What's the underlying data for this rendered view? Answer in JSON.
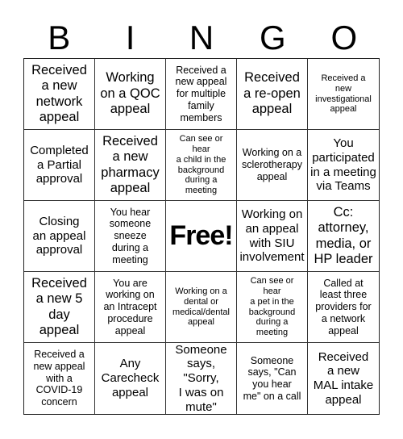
{
  "title_letters": [
    "B",
    "I",
    "N",
    "G",
    "O"
  ],
  "cells": [
    {
      "text": "Received\na new\nnetwork\nappeal",
      "size": "xl"
    },
    {
      "text": "Working\non a QOC\nappeal",
      "size": "xl"
    },
    {
      "text": "Received a\nnew appeal\nfor multiple\nfamily\nmembers",
      "size": "md"
    },
    {
      "text": "Received\na re-open\nappeal",
      "size": "xl"
    },
    {
      "text": "Received a\nnew\ninvestigational\nappeal",
      "size": "sm"
    },
    {
      "text": "Completed\na Partial\napproval",
      "size": "lg"
    },
    {
      "text": "Received\na new\npharmacy\nappeal",
      "size": "xl"
    },
    {
      "text": "Can see or\nhear\na child in the\nbackground\nduring a\nmeeting",
      "size": "sm"
    },
    {
      "text": "Working on a\nsclerotherapy\nappeal",
      "size": "md"
    },
    {
      "text": "You\nparticipated\nin a meeting\nvia Teams",
      "size": "lg"
    },
    {
      "text": "Closing\nan appeal\napproval",
      "size": "lg"
    },
    {
      "text": "You hear\nsomeone\nsneeze\nduring a\nmeeting",
      "size": "md"
    },
    {
      "text": "Free!",
      "size": "free"
    },
    {
      "text": "Working on\nan appeal\nwith SIU\ninvolvement",
      "size": "lg"
    },
    {
      "text": "Cc:\nattorney,\nmedia, or\nHP leader",
      "size": "xl"
    },
    {
      "text": "Received\na new 5\nday\nappeal",
      "size": "xl"
    },
    {
      "text": "You are\nworking on\nan Intracept\nprocedure\nappeal",
      "size": "md"
    },
    {
      "text": "Working on a\ndental or\nmedical/dental\nappeal",
      "size": "sm"
    },
    {
      "text": "Can see or\nhear\na pet in the\nbackground\nduring a\nmeeting",
      "size": "sm"
    },
    {
      "text": "Called at\nleast three\nproviders for\na network\nappeal",
      "size": "md"
    },
    {
      "text": "Received a\nnew appeal\nwith a\nCOVID-19\nconcern",
      "size": "md"
    },
    {
      "text": "Any\nCarecheck\nappeal",
      "size": "lg"
    },
    {
      "text": "Someone\nsays, \"Sorry,\nI was on\nmute\"",
      "size": "lg"
    },
    {
      "text": "Someone\nsays, \"Can\nyou hear\nme\" on a call",
      "size": "md"
    },
    {
      "text": "Received\na new\nMAL intake\nappeal",
      "size": "lg"
    }
  ]
}
